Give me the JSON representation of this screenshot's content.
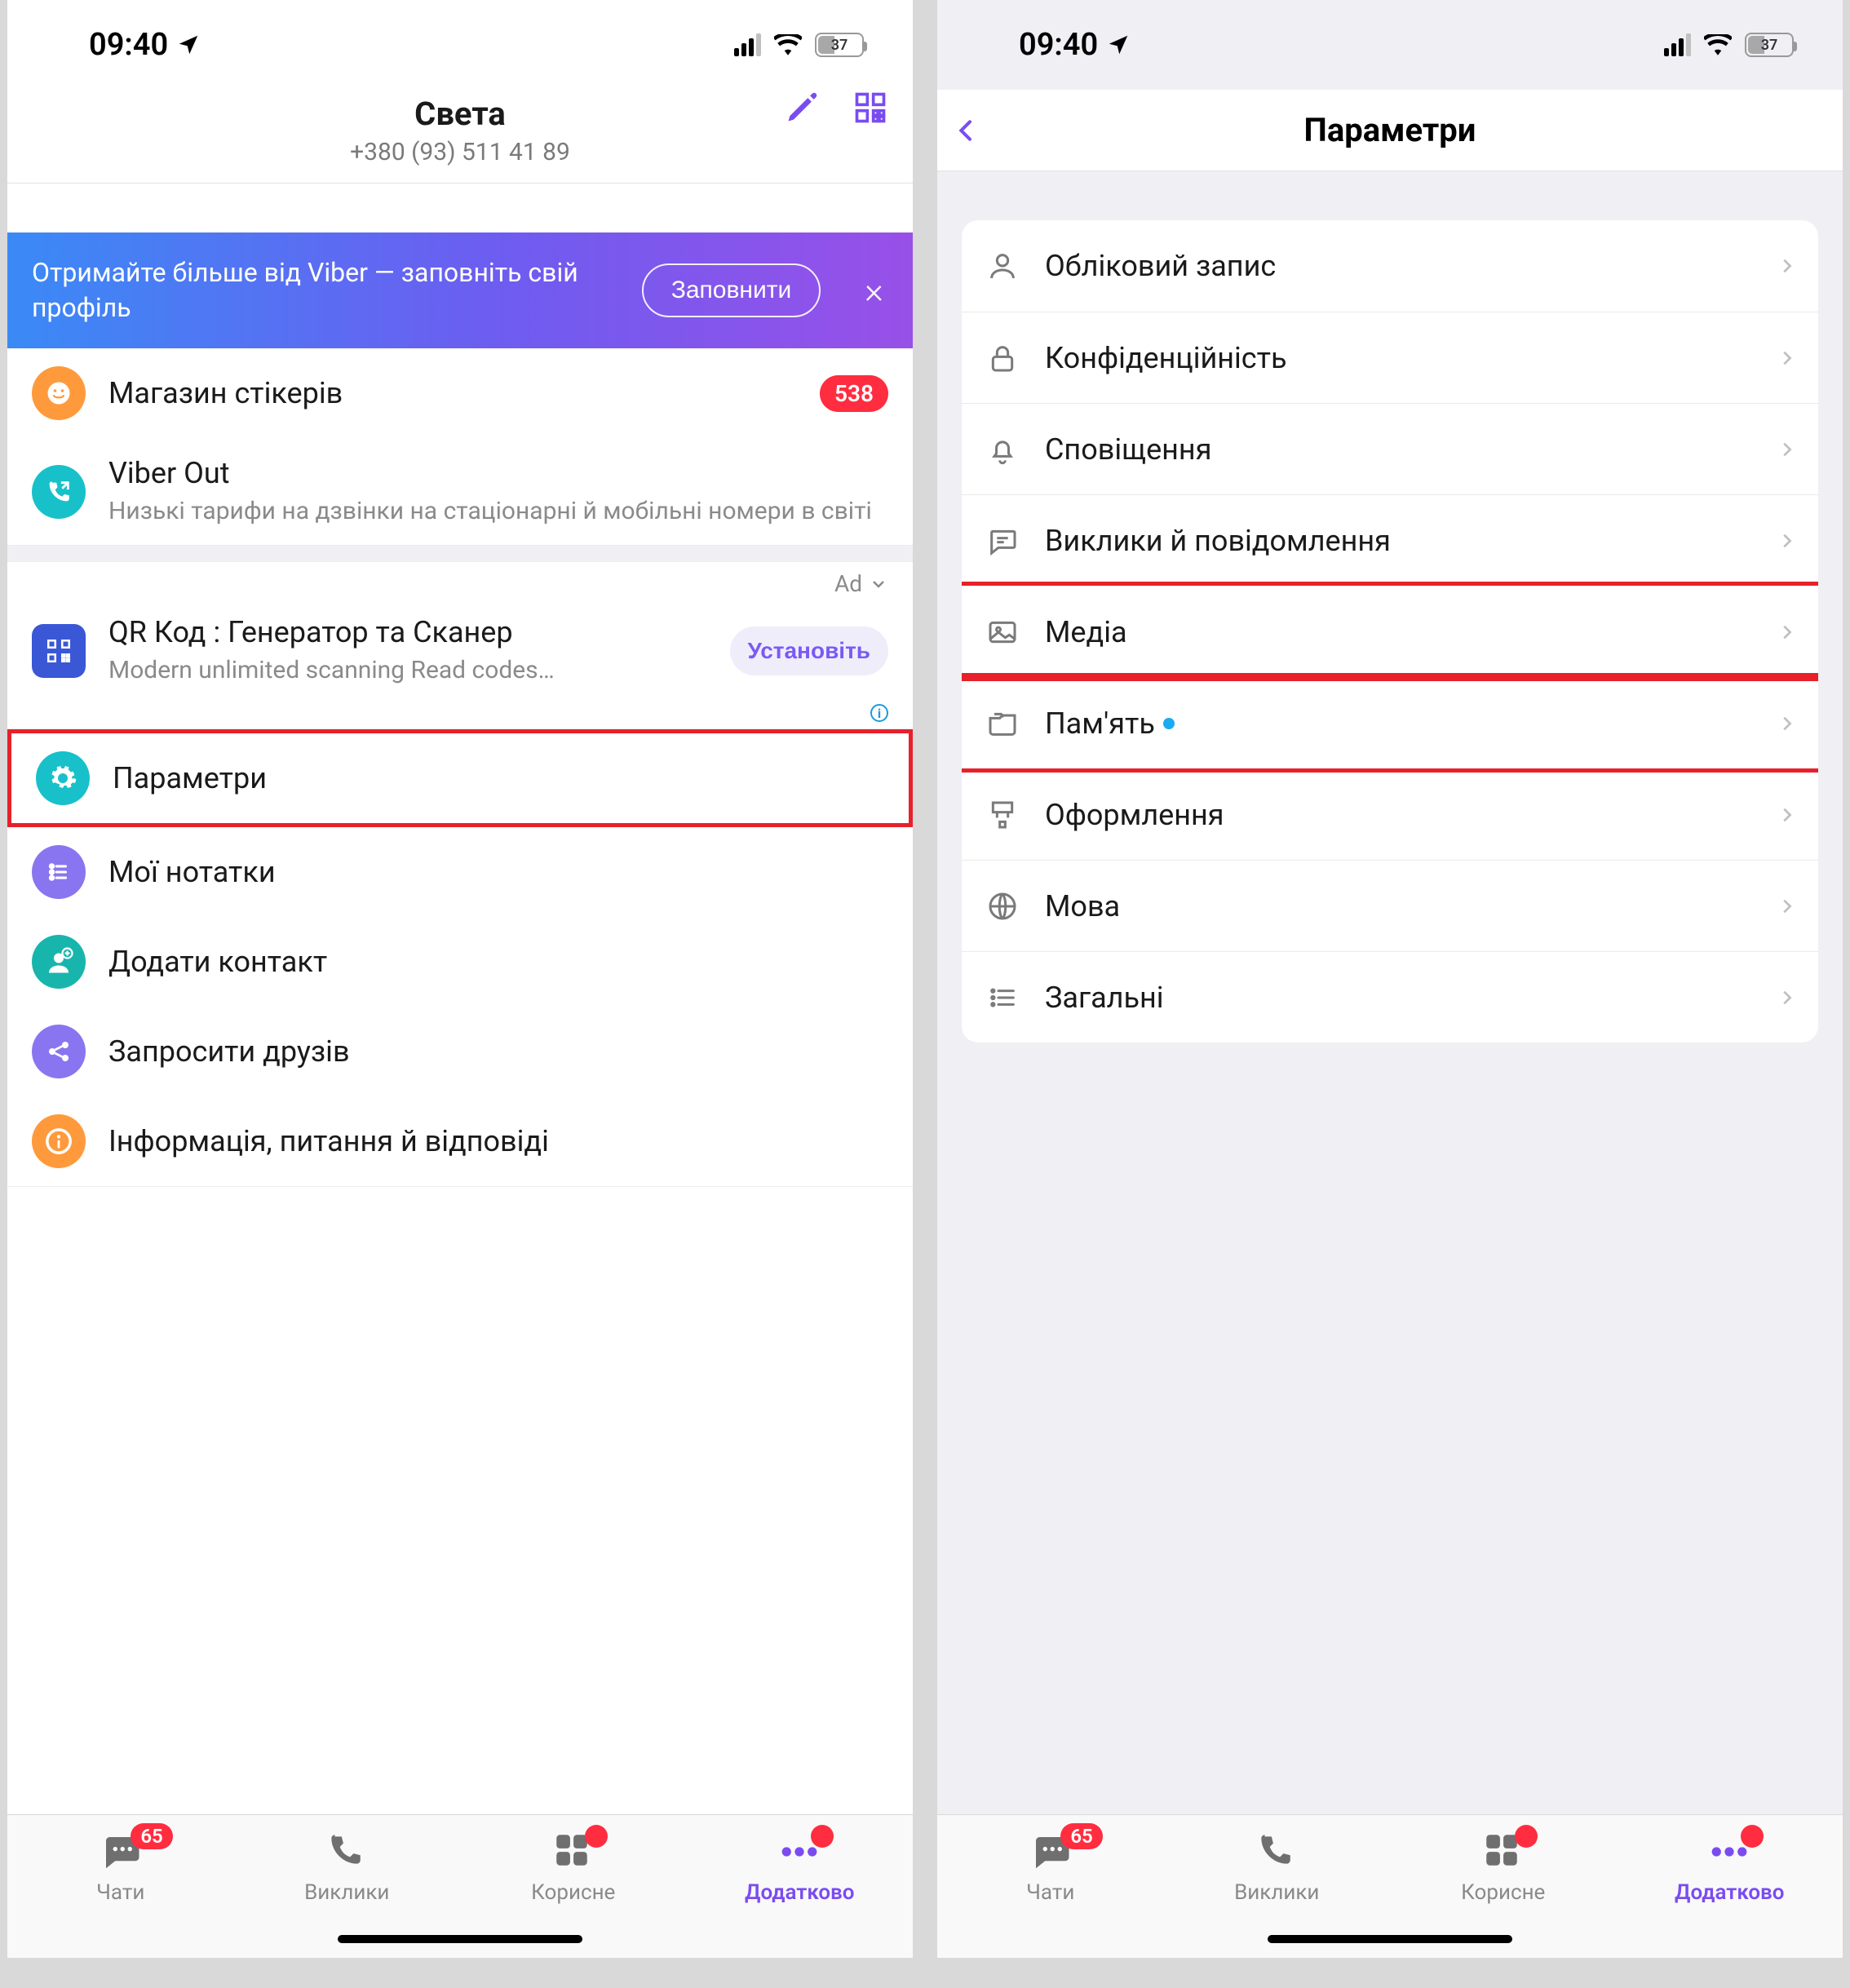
{
  "status": {
    "time": "09:40",
    "battery": "37"
  },
  "left": {
    "profile": {
      "name": "Света",
      "phone": "+380 (93) 511 41 89"
    },
    "banner": {
      "text": "Отримайте більше від Viber — заповніть свій профіль",
      "button": "Заповнити"
    },
    "stickers": {
      "label": "Магазин стікерів",
      "badge": "538"
    },
    "viberout": {
      "title": "Viber Out",
      "sub": "Низькі тарифи на дзвінки на стаціонарні й мобільні номери в світі"
    },
    "ad": {
      "label": "Ad",
      "title": "QR Код : Генератор та Сканер",
      "sub": "Modern unlimited scanning Read codes…",
      "install": "Установіть"
    },
    "items": {
      "settings": "Параметри",
      "notes": "Мої нотатки",
      "addcontact": "Додати контакт",
      "invite": "Запросити друзів",
      "info": "Інформація, питання й відповіді"
    }
  },
  "right": {
    "title": "Параметри",
    "rows": {
      "account": "Обліковий запис",
      "privacy": "Конфіденційність",
      "notifications": "Сповіщення",
      "calls": "Виклики й повідомлення",
      "media": "Медіа",
      "storage": "Пам'ять",
      "appearance": "Оформлення",
      "language": "Мова",
      "general": "Загальні"
    }
  },
  "tabs": {
    "chats": "Чати",
    "chats_count": "65",
    "calls": "Виклики",
    "useful": "Корисне",
    "more": "Додатково"
  }
}
